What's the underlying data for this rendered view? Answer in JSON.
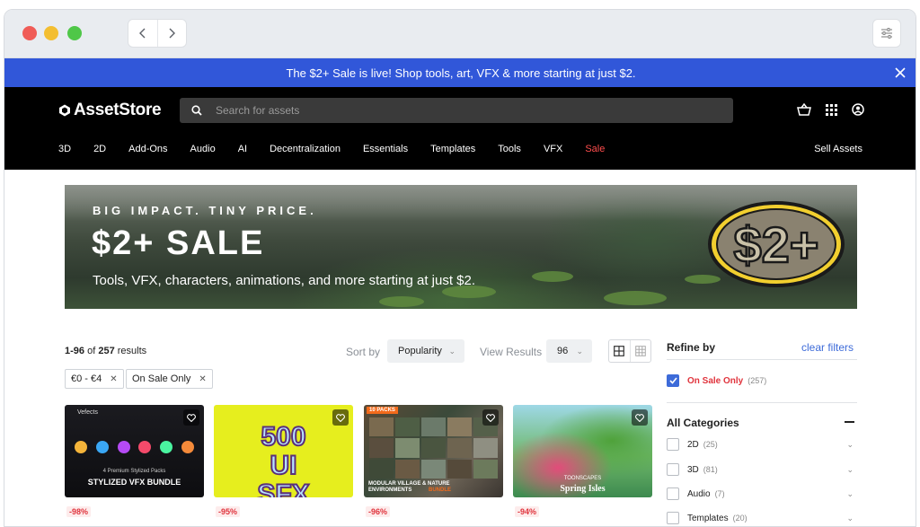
{
  "promo": {
    "message": "The $2+ Sale is live! Shop tools, art, VFX & more starting at just $2."
  },
  "header": {
    "logo_text": "AssetStore",
    "search_placeholder": "Search for assets",
    "categories": [
      "3D",
      "2D",
      "Add-Ons",
      "Audio",
      "AI",
      "Decentralization",
      "Essentials",
      "Templates",
      "Tools",
      "VFX",
      "Sale"
    ],
    "sell_label": "Sell Assets"
  },
  "banner": {
    "tagline": "BIG IMPACT. TINY PRICE.",
    "title": "$2+ SALE",
    "subtitle": "Tools, VFX, characters, animations, and more starting at just $2.",
    "badge_text": "$2+"
  },
  "results": {
    "range": "1-96",
    "of_label": "of",
    "total": "257",
    "results_label": "results",
    "sort_label": "Sort by",
    "sort_value": "Popularity",
    "view_label": "View Results",
    "view_value": "96"
  },
  "filters": [
    {
      "label": "€0 - €4"
    },
    {
      "label": "On Sale Only"
    }
  ],
  "cards": [
    {
      "title_text": "STYLIZED VFX BUNDLE",
      "sub_text": "4 Premium Stylized Packs",
      "brand": "Vefects",
      "discount": "-98%"
    },
    {
      "title_text": "500 UI SFX",
      "discount": "-95%"
    },
    {
      "title_text": "MODULAR VILLAGE & NATURE ENVIRONMENTS",
      "tag": "10 PACKS",
      "accent": "BUNDLE",
      "discount": "-96%"
    },
    {
      "title_text": "Spring Isles",
      "brand": "TOONSCAPES",
      "discount": "-94%"
    }
  ],
  "sidebar": {
    "refine_label": "Refine by",
    "clear_label": "clear filters",
    "on_sale_label": "On Sale Only",
    "on_sale_count": "(257)",
    "all_categories_label": "All Categories",
    "categories": [
      {
        "label": "2D",
        "count": "(25)"
      },
      {
        "label": "3D",
        "count": "(81)"
      },
      {
        "label": "Audio",
        "count": "(7)"
      },
      {
        "label": "Templates",
        "count": "(20)"
      }
    ]
  },
  "colors": {
    "promo_bg": "#3157d9",
    "sale_red": "#e0343d",
    "link_blue": "#3d6bd9"
  }
}
